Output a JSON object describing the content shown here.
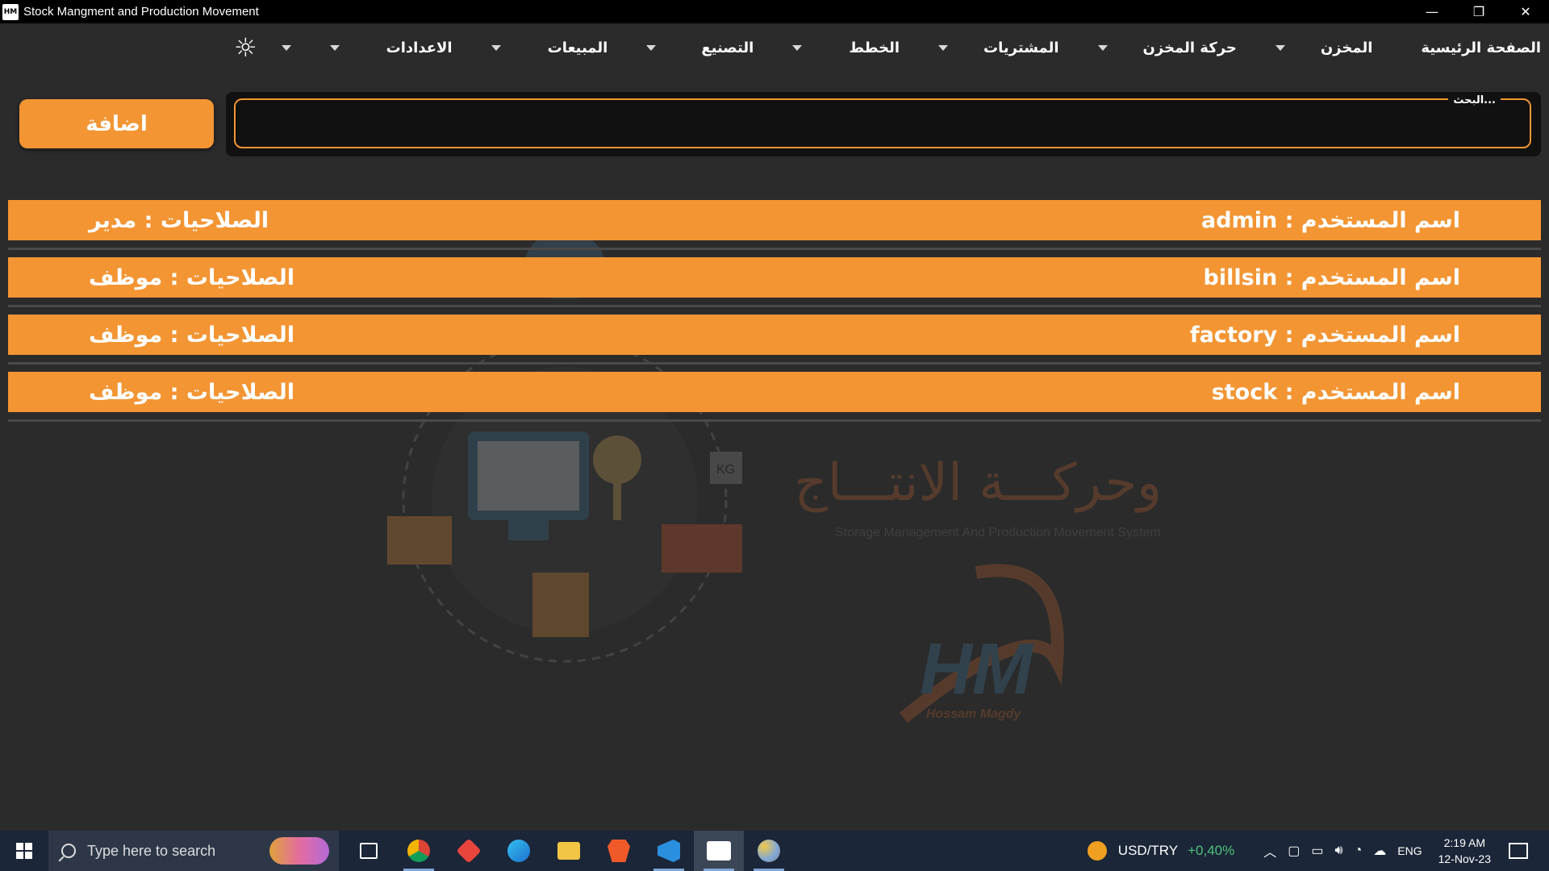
{
  "window": {
    "title": "Stock Mangment and Production Movement",
    "app_icon": "HM",
    "minimize": "—",
    "restore": "❐",
    "close": "✕"
  },
  "menu": {
    "items": [
      {
        "label": "الصفحة الرئيسية",
        "has_dropdown": false
      },
      {
        "label": "المخزن",
        "has_dropdown": true
      },
      {
        "label": "حركة المخزن",
        "has_dropdown": true
      },
      {
        "label": "المشتريات",
        "has_dropdown": true
      },
      {
        "label": "الخطط",
        "has_dropdown": true
      },
      {
        "label": "التصنيع",
        "has_dropdown": true
      },
      {
        "label": "المبيعات",
        "has_dropdown": true
      },
      {
        "label": "الاعدادات",
        "has_dropdown": true
      }
    ],
    "theme_icon": "☼"
  },
  "search": {
    "label": "البحث...",
    "value": ""
  },
  "add_button": "اضافة",
  "users": [
    {
      "name_text": "اسم المستخدم : admin",
      "perm_text": "الصلاحيات : مدير"
    },
    {
      "name_text": "اسم المستخدم : billsin",
      "perm_text": "الصلاحيات : موظف"
    },
    {
      "name_text": "اسم المستخدم : factory",
      "perm_text": "الصلاحيات : موظف"
    },
    {
      "name_text": "اسم المستخدم : stock",
      "perm_text": "الصلاحيات : موظف"
    }
  ],
  "watermark": {
    "title_line": "وحركـــة الانتـــاج",
    "subtitle": "Storage Management And Production Movement System",
    "logo_text": "HM",
    "author": "Hossam Magdy",
    "kg_label": "KG"
  },
  "taskbar": {
    "search_placeholder": "Type here to search",
    "ticker_pair": "USD/TRY",
    "ticker_change": "+0,40%",
    "language": "ENG",
    "time": "2:19 AM",
    "date": "12-Nov-23",
    "app_icons": [
      "task-view-icon",
      "chrome-icon",
      "git-icon",
      "edge-icon",
      "file-explorer-icon",
      "brave-icon",
      "vscode-icon",
      "hm-app-icon",
      "paint-icon"
    ],
    "colors": {
      "accent": "#f39533",
      "taskbar_bg": "#1b2638"
    }
  }
}
